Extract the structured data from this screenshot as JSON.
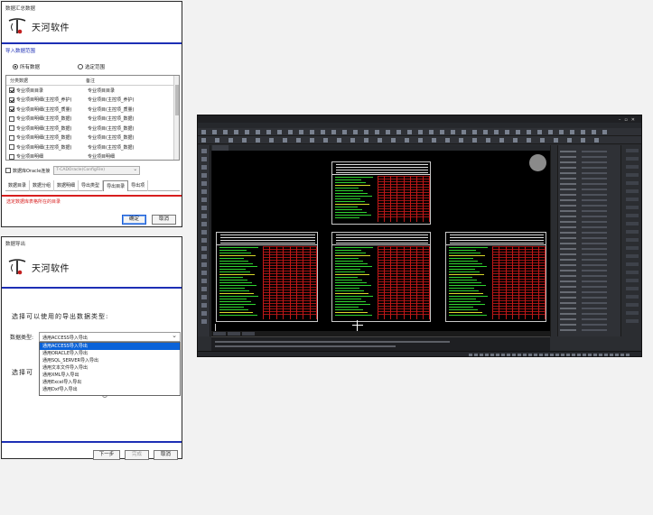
{
  "dialog1": {
    "title": "数据汇总数据",
    "logo_text": "天河软件",
    "section_label": "导入数据范围",
    "radio_all": "所有数据",
    "radio_custom": "选定范围",
    "columns": [
      "分类数据",
      "备注"
    ],
    "rows": [
      {
        "checked": true,
        "name": "专业项目目录",
        "note": "专业项目目录"
      },
      {
        "checked": true,
        "name": "专业项目明细(主控项_养护)",
        "note": "专业项目(主控项_养护)"
      },
      {
        "checked": true,
        "name": "专业项目明细(主控项_质量)",
        "note": "专业项目(主控项_质量)"
      },
      {
        "checked": false,
        "name": "专业项目明细(主控项_数据)",
        "note": "专业项目(主控项_数据)"
      },
      {
        "checked": false,
        "name": "专业项目明细(主控项_数据)",
        "note": "专业项目(主控项_数据)"
      },
      {
        "checked": false,
        "name": "专业项目明细(主控项_数据)",
        "note": "专业项目(主控项_数据)"
      },
      {
        "checked": false,
        "name": "专业项目明细(主控项_数据)",
        "note": "专业项目(主控项_数据)"
      },
      {
        "checked": false,
        "name": "专业项目明细",
        "note": "专业项目明细"
      }
    ],
    "db_check_label": "数据库Oracle连接",
    "db_select_value": "T-CADOracle(ConfigFile)",
    "tabs": [
      "数据目录",
      "数据分组",
      "数据明细",
      "导出类型",
      "导出目录",
      "导出项"
    ],
    "active_tab_index": 4,
    "red_note": "选定数据库表格所在的目录",
    "ok_label": "确定",
    "cancel_label": "取消"
  },
  "dialog2": {
    "title": "数据导出",
    "logo_text": "天河软件",
    "prompt": "选择可以使用的导出数据类型:",
    "type_label": "数据类型:",
    "selected_value": "通用ACCESS导入导出",
    "options": [
      "通用ACCESS导入导出",
      "通用ORACLE导入导出",
      "通用SQL_SERVER导入导出",
      "通用文本文件导入导出",
      "通用XML导入导出",
      "通用Excel导入导出",
      "通用Dxf导入导出"
    ],
    "behind_label": "选择可",
    "next_label": "下一步",
    "finish_label": "完成",
    "cancel_label": "取消"
  },
  "cad": {
    "colors": {
      "background": "#000000",
      "grid_red": "#c01818",
      "text_green": "#30d430",
      "frame": "#c8c8c8"
    }
  }
}
